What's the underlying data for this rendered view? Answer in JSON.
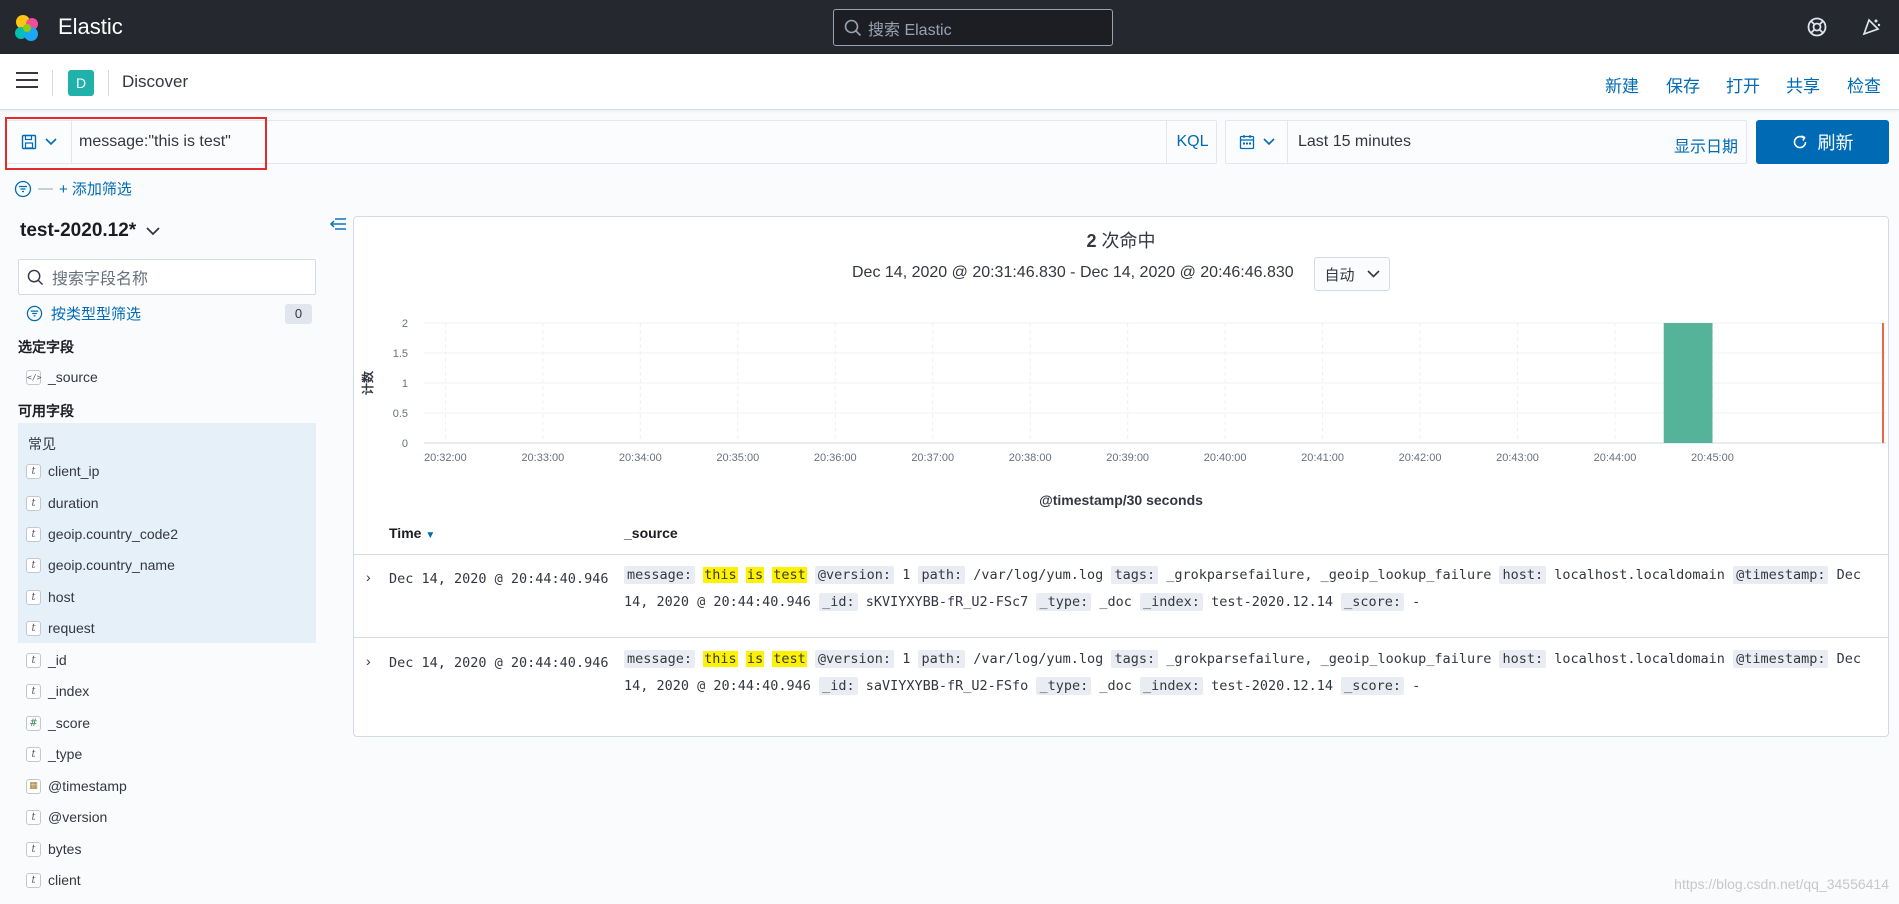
{
  "app": {
    "brand": "Elastic",
    "global_search_placeholder": "搜索 Elastic"
  },
  "nav": {
    "space_badge": "D",
    "breadcrumb": "Discover",
    "menu": [
      "新建",
      "保存",
      "打开",
      "共享",
      "检查"
    ]
  },
  "query": {
    "text": "message:\"this is test\"",
    "language": "KQL"
  },
  "time": {
    "label": "Last 15 minutes",
    "show_dates": "显示日期",
    "refresh": "刷新"
  },
  "filters": {
    "add": "+ 添加筛选"
  },
  "sidebar": {
    "index_pattern": "test-2020.12*",
    "search_placeholder": "搜索字段名称",
    "filter_by_type": "按类型型筛选",
    "filter_count": "0",
    "selected_heading": "选定字段",
    "selected_fields": [
      {
        "name": "_source",
        "type": "source"
      }
    ],
    "available_heading": "可用字段",
    "common_heading": "常见",
    "common_fields": [
      {
        "name": "client_ip",
        "type": "t"
      },
      {
        "name": "duration",
        "type": "t"
      },
      {
        "name": "geoip.country_code2",
        "type": "t"
      },
      {
        "name": "geoip.country_name",
        "type": "t"
      },
      {
        "name": "host",
        "type": "t"
      },
      {
        "name": "request",
        "type": "t"
      }
    ],
    "other_fields": [
      {
        "name": "_id",
        "type": "t"
      },
      {
        "name": "_index",
        "type": "t"
      },
      {
        "name": "_score",
        "type": "#"
      },
      {
        "name": "_type",
        "type": "t"
      },
      {
        "name": "@timestamp",
        "type": "date"
      },
      {
        "name": "@version",
        "type": "t"
      },
      {
        "name": "bytes",
        "type": "t"
      },
      {
        "name": "client",
        "type": "t"
      }
    ]
  },
  "results": {
    "hits_count": "2",
    "hits_label": "次命中",
    "range": "Dec 14, 2020 @ 20:31:46.830 - Dec 14, 2020 @ 20:46:46.830",
    "interval": "自动",
    "col_time": "Time",
    "col_source": "_source",
    "rows": [
      {
        "time": "Dec 14, 2020 @ 20:44:40.946",
        "msg_key": "message:",
        "msg_words": [
          "this",
          "is",
          "test"
        ],
        "fields": [
          {
            "k": "@version:",
            "v": "1"
          },
          {
            "k": "path:",
            "v": "/var/log/yum.log"
          },
          {
            "k": "tags:",
            "v": "_grokparsefailure, _geoip_lookup_failure"
          },
          {
            "k": "host:",
            "v": "localhost.localdomain"
          },
          {
            "k": "@timestamp:",
            "v": "Dec 14, 2020 @ 20:44:40.946"
          },
          {
            "k": "_id:",
            "v": "sKVIYXYBB-fR_U2-FSc7"
          },
          {
            "k": "_type:",
            "v": "_doc"
          },
          {
            "k": "_index:",
            "v": "test-2020.12.14"
          },
          {
            "k": "_score:",
            "v": "-"
          }
        ]
      },
      {
        "time": "Dec 14, 2020 @ 20:44:40.946",
        "msg_key": "message:",
        "msg_words": [
          "this",
          "is",
          "test"
        ],
        "fields": [
          {
            "k": "@version:",
            "v": "1"
          },
          {
            "k": "path:",
            "v": "/var/log/yum.log"
          },
          {
            "k": "tags:",
            "v": "_grokparsefailure, _geoip_lookup_failure"
          },
          {
            "k": "host:",
            "v": "localhost.localdomain"
          },
          {
            "k": "@timestamp:",
            "v": "Dec 14, 2020 @ 20:44:40.946"
          },
          {
            "k": "_id:",
            "v": "saVIYXYBB-fR_U2-FSfo"
          },
          {
            "k": "_type:",
            "v": "_doc"
          },
          {
            "k": "_index:",
            "v": "test-2020.12.14"
          },
          {
            "k": "_score:",
            "v": "-"
          }
        ]
      }
    ]
  },
  "chart_data": {
    "type": "bar",
    "xlabel": "@timestamp/30 seconds",
    "ylabel": "计数",
    "x_ticks": [
      "20:32:00",
      "20:33:00",
      "20:34:00",
      "20:35:00",
      "20:36:00",
      "20:37:00",
      "20:38:00",
      "20:39:00",
      "20:40:00",
      "20:41:00",
      "20:42:00",
      "20:43:00",
      "20:44:00",
      "20:45:00"
    ],
    "y_ticks": [
      "0",
      "0.5",
      "1",
      "1.5",
      "2"
    ],
    "ylim": [
      0,
      2
    ],
    "x_range": [
      "20:31:46.830",
      "20:46:46.830"
    ],
    "bars": [
      {
        "start": "20:44:30",
        "end": "20:45:00",
        "value": 2
      }
    ],
    "now_marker": "20:46:46.830",
    "bar_color": "#54b399",
    "marker_color": "#e7664c",
    "grid": true
  },
  "watermark": "https://blog.csdn.net/qq_34556414"
}
